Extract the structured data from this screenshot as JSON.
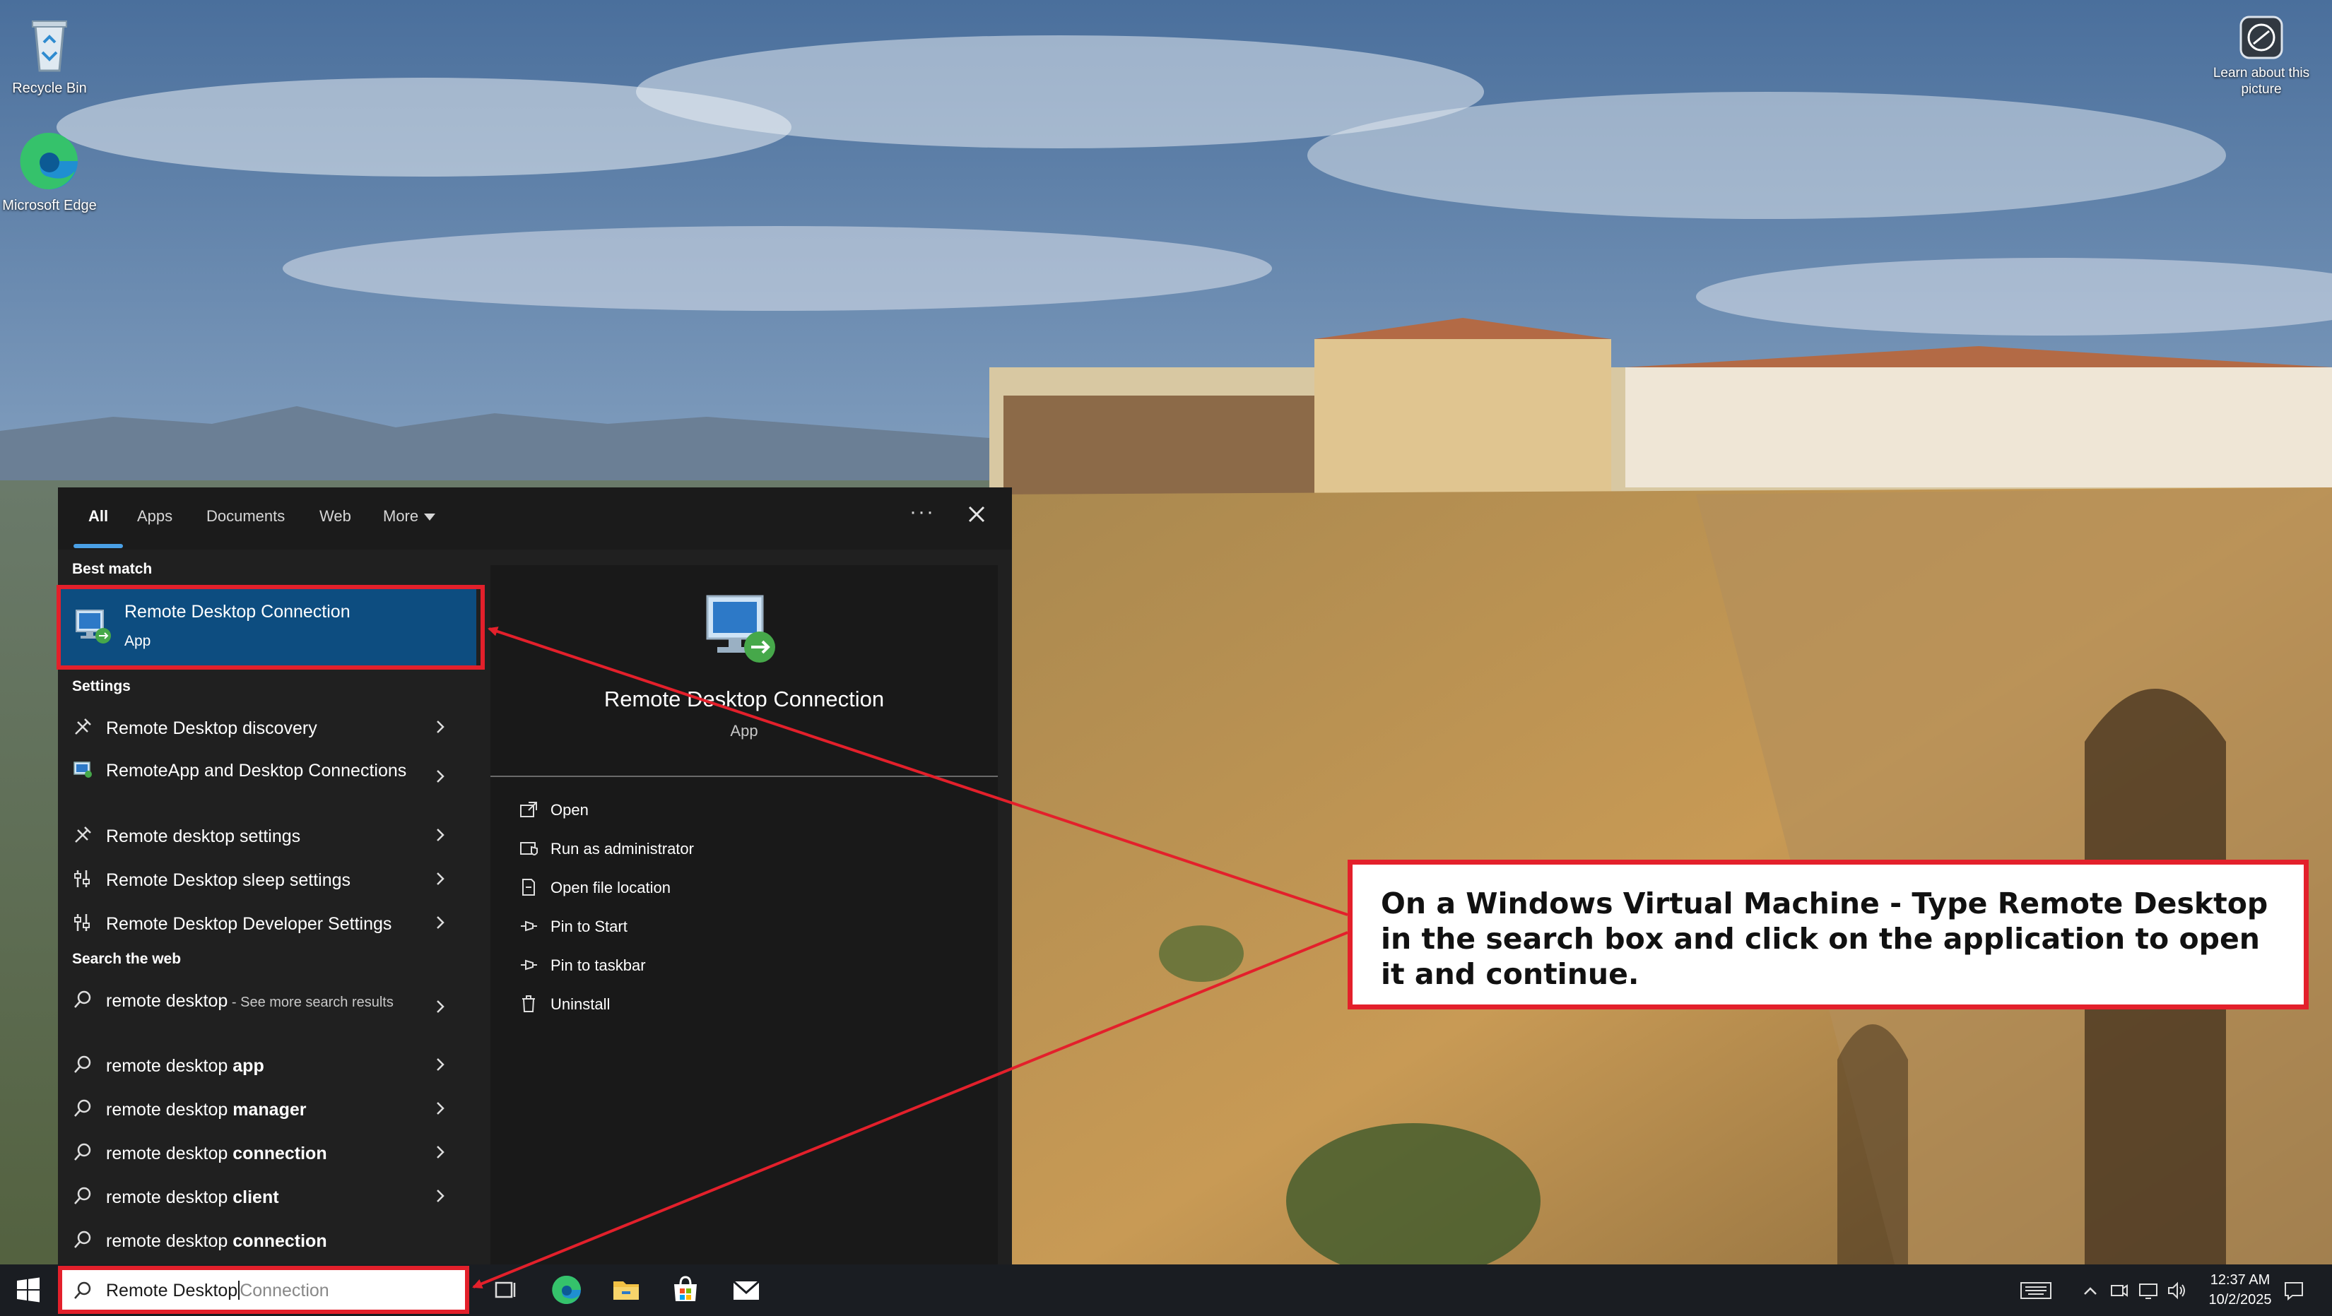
{
  "desktop": {
    "icons": [
      {
        "label": "Recycle Bin",
        "icon": "recycle-bin-icon"
      },
      {
        "label": "Microsoft Edge",
        "icon": "edge-icon"
      }
    ],
    "learn_about": "Learn about this picture"
  },
  "search_panel": {
    "tabs": [
      {
        "label": "All",
        "active": true
      },
      {
        "label": "Apps"
      },
      {
        "label": "Documents"
      },
      {
        "label": "Web"
      },
      {
        "label": "More"
      }
    ],
    "more_options_icon": "ellipsis-icon",
    "close_icon": "close-icon",
    "best_match": {
      "section_title": "Best match",
      "title": "Remote Desktop Connection",
      "subtitle": "App",
      "icon": "remote-desktop-icon"
    },
    "settings": {
      "section_title": "Settings",
      "items": [
        {
          "label": "Remote Desktop discovery",
          "icon": "tools-icon"
        },
        {
          "label": "RemoteApp and Desktop Connections",
          "icon": "control-panel-icon"
        },
        {
          "label": "Remote desktop settings",
          "icon": "tools-icon"
        },
        {
          "label": "Remote Desktop sleep settings",
          "icon": "developer-sliders-icon"
        },
        {
          "label": "Remote Desktop Developer Settings",
          "icon": "developer-sliders-icon"
        }
      ]
    },
    "web": {
      "section_title": "Search the web",
      "items": [
        {
          "prefix": "remote desktop",
          "bold": "",
          "suffix": " - See more search results"
        },
        {
          "prefix": "remote desktop ",
          "bold": "app",
          "suffix": ""
        },
        {
          "prefix": "remote desktop ",
          "bold": "manager",
          "suffix": ""
        },
        {
          "prefix": "remote desktop ",
          "bold": "connection",
          "suffix": ""
        },
        {
          "prefix": "remote desktop ",
          "bold": "client",
          "suffix": ""
        },
        {
          "prefix": "remote desktop ",
          "bold": "connection",
          "suffix": ""
        }
      ]
    },
    "detail": {
      "title": "Remote Desktop Connection",
      "subtitle": "App",
      "actions": [
        {
          "label": "Open",
          "icon": "open-icon"
        },
        {
          "label": "Run as administrator",
          "icon": "shield-icon"
        },
        {
          "label": "Open file location",
          "icon": "file-location-icon"
        },
        {
          "label": "Pin to Start",
          "icon": "pin-icon"
        },
        {
          "label": "Pin to taskbar",
          "icon": "pin-icon"
        },
        {
          "label": "Uninstall",
          "icon": "trash-icon"
        }
      ]
    }
  },
  "taskbar": {
    "search_typed": "Remote Desktop",
    "search_suggestion": "Connection",
    "apps": [
      "task-view-icon",
      "edge-icon",
      "file-explorer-icon",
      "store-icon",
      "mail-icon"
    ],
    "clock_time": "12:37 AM",
    "clock_date": "10/2/2025"
  },
  "callout": {
    "text": "On a Windows Virtual Machine - Type Remote Desktop in the search box and click on the application to open it and continue.",
    "color": "#e3202b"
  },
  "colors": {
    "accent": "#0d4d80",
    "highlight_frame": "#e3202b",
    "panel_bg": "#202020"
  }
}
